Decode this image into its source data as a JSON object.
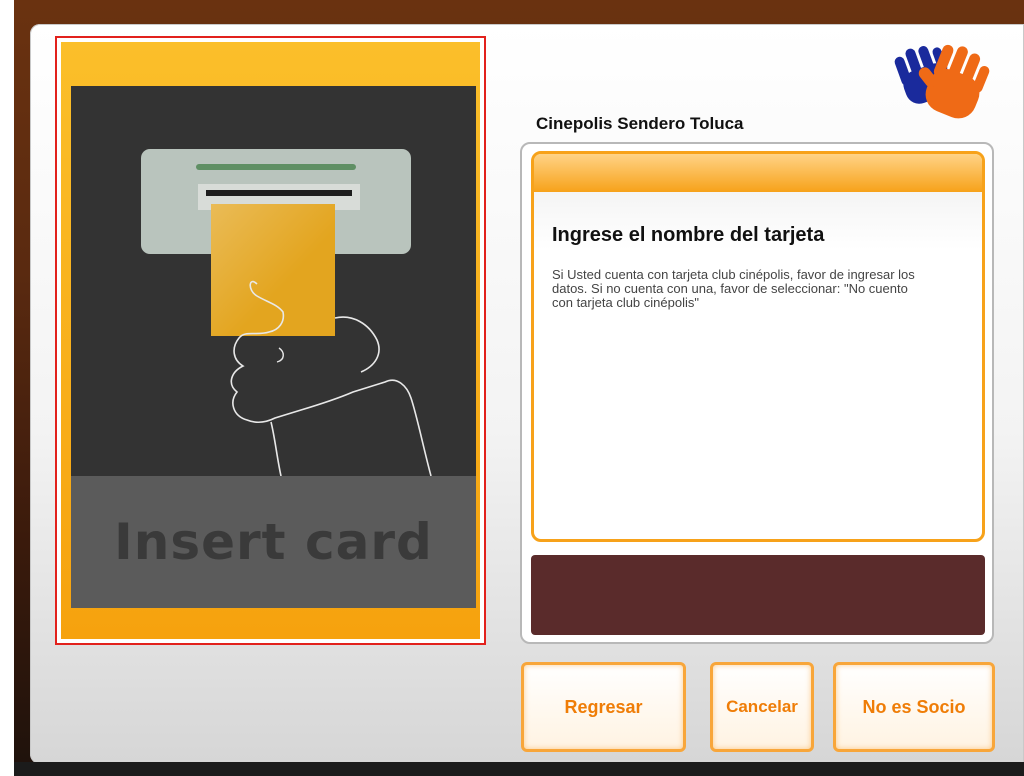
{
  "reader": {
    "insert_label": "Insert card"
  },
  "header": {
    "location_title": "Cinepolis Sendero Toluca",
    "logo_icon": "waving-hands-logo"
  },
  "info": {
    "title": "Ingrese el nombre del tarjeta",
    "message": "Si Usted cuenta con tarjeta club cinépolis, favor de ingresar los datos. Si no cuenta con una, favor de seleccionar: \"No cuento con tarjeta club cinépolis\""
  },
  "buttons": {
    "back_label": "Regresar",
    "cancel_label": "Cancelar",
    "not_member_label": "No es Socio"
  },
  "colors": {
    "accent_orange": "#f7a21a",
    "button_text": "#ef7d07",
    "message_bar": "#5a2b2b",
    "highlight_border": "#e2211c"
  }
}
